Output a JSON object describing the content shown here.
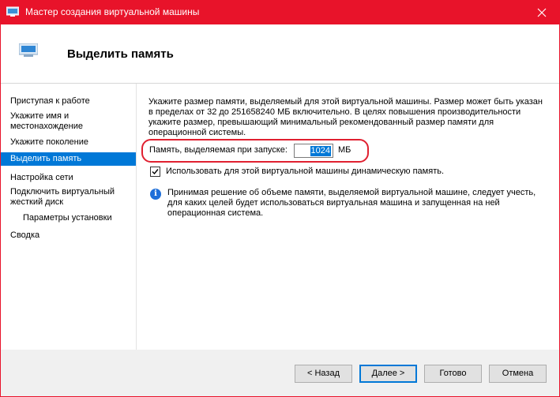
{
  "window": {
    "title": "Мастер создания виртуальной машины"
  },
  "header": {
    "title": "Выделить память"
  },
  "nav": {
    "items": [
      {
        "label": "Приступая к работе"
      },
      {
        "label": "Укажите имя и местонахождение"
      },
      {
        "label": "Укажите поколение"
      },
      {
        "label": "Выделить память",
        "selected": true
      },
      {
        "label": "Настройка сети"
      },
      {
        "label": "Подключить виртуальный жесткий диск"
      },
      {
        "label": "Параметры установки"
      },
      {
        "label": "Сводка"
      }
    ]
  },
  "main": {
    "description": "Укажите размер памяти, выделяемый для этой виртуальной машины. Размер может быть указан в пределах от 32 до 251658240 МБ включительно. В целях повышения производительности укажите размер, превышающий минимальный рекомендованный размер памяти для операционной системы.",
    "memory_label": "Память, выделяемая при запуске:",
    "memory_value": "1024",
    "memory_unit": "МБ",
    "dynamic_memory_label": "Использовать для этой виртуальной машины динамическую память.",
    "dynamic_memory_checked": true,
    "info_text": "Принимая решение об объеме памяти, выделяемой виртуальной машине, следует учесть, для каких целей будет использоваться виртуальная машина и запущенная на ней операционная система."
  },
  "buttons": {
    "back": "< Назад",
    "next": "Далее >",
    "finish": "Готово",
    "cancel": "Отмена"
  },
  "colors": {
    "titlebar": "#e8132a",
    "accent": "#0078d7",
    "highlight_oval": "#e02030"
  }
}
